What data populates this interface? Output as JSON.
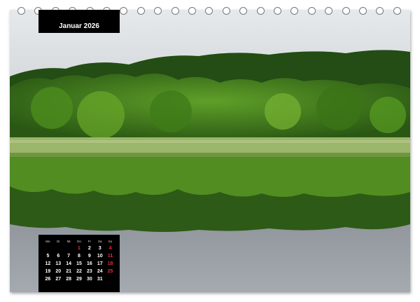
{
  "month": {
    "label": "Januar 2026"
  },
  "calendar": {
    "weekdays": [
      "Mo",
      "Di",
      "Mi",
      "Do",
      "Fr",
      "Sa",
      "So"
    ],
    "weeks": [
      [
        "",
        "",
        "",
        "1",
        "2",
        "3",
        "4"
      ],
      [
        "5",
        "6",
        "7",
        "8",
        "9",
        "10",
        "11"
      ],
      [
        "12",
        "13",
        "14",
        "15",
        "16",
        "17",
        "18"
      ],
      [
        "19",
        "20",
        "21",
        "22",
        "23",
        "24",
        "25"
      ],
      [
        "26",
        "27",
        "28",
        "29",
        "30",
        "31",
        ""
      ]
    ],
    "highlight_days": [
      "1"
    ],
    "sunday_color": "#e0303a"
  },
  "colors": {
    "sky": "#dde0e3",
    "foliage_dark": "#1f4a12",
    "foliage_bright": "#5f9f2a",
    "reed": "#8fb060",
    "water": "#8c9298"
  }
}
